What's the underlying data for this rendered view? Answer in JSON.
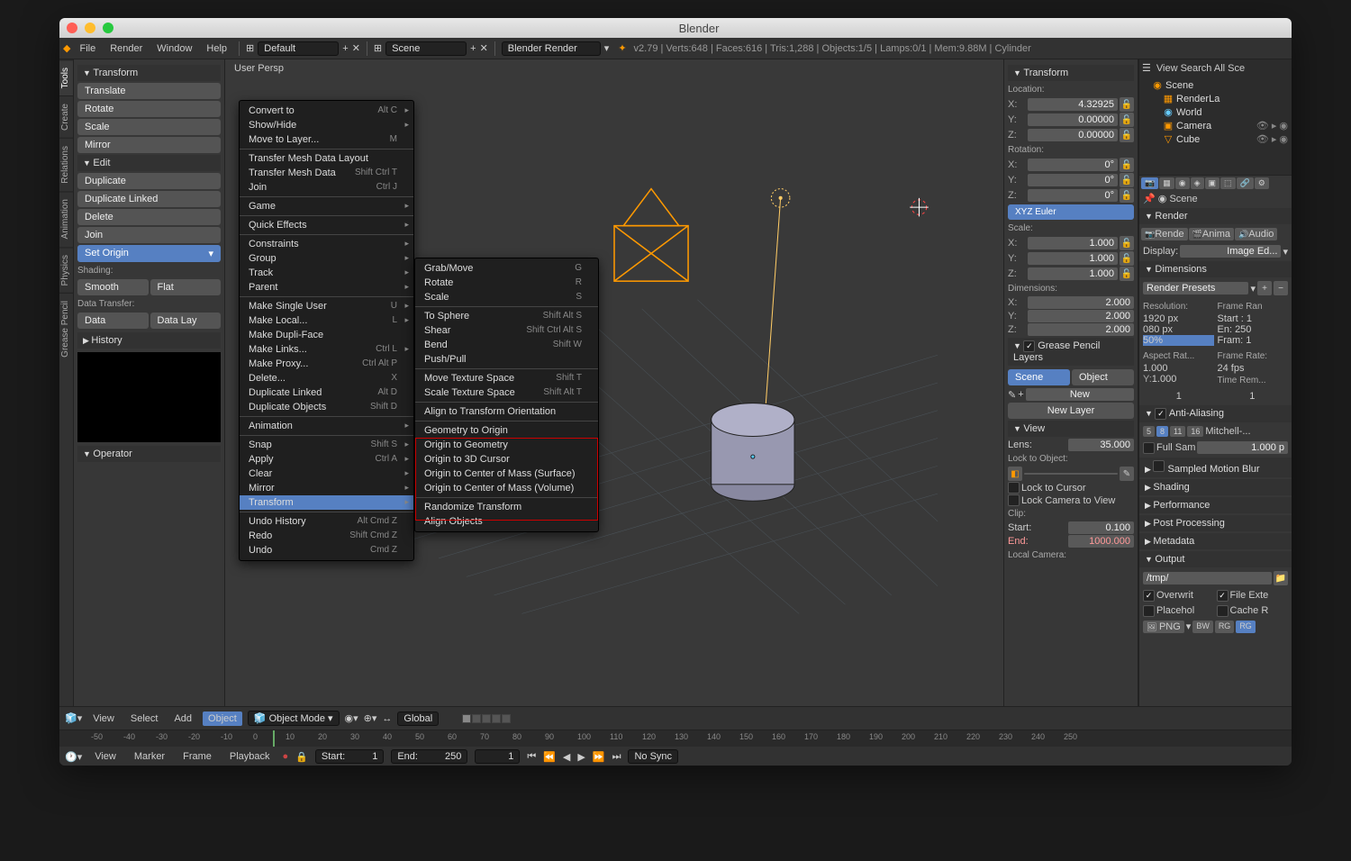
{
  "title": "Blender",
  "menubar": {
    "file": "File",
    "render": "Render",
    "window": "Window",
    "help": "Help",
    "layout": "Default",
    "scene": "Scene",
    "engine": "Blender Render"
  },
  "info": "v2.79 | Verts:648 | Faces:616 | Tris:1,288 | Objects:1/5 | Lamps:0/1 | Mem:9.88M | Cylinder",
  "vtabs": [
    "Tools",
    "Create",
    "Relations",
    "Animation",
    "Physics",
    "Grease Pencil"
  ],
  "toolpanel": {
    "transform": {
      "head": "Transform",
      "translate": "Translate",
      "rotate": "Rotate",
      "scale": "Scale",
      "mirror": "Mirror"
    },
    "edit": {
      "head": "Edit",
      "duplicate": "Duplicate",
      "duplink": "Duplicate Linked",
      "delete": "Delete",
      "join": "Join",
      "setorigin": "Set Origin"
    },
    "shading": {
      "label": "Shading:",
      "smooth": "Smooth",
      "flat": "Flat"
    },
    "datatrans": {
      "label": "Data Transfer:",
      "data": "Data",
      "datalay": "Data Lay"
    },
    "history": "History",
    "operator": "Operator"
  },
  "persp": "User Persp",
  "menu1": [
    {
      "t": "Convert to",
      "s": "Alt C",
      "sub": true
    },
    {
      "t": "Show/Hide",
      "sub": true
    },
    {
      "t": "Move to Layer...",
      "s": "M"
    },
    {
      "sep": true
    },
    {
      "t": "Transfer Mesh Data Layout"
    },
    {
      "t": "Transfer Mesh Data",
      "s": "Shift Ctrl T"
    },
    {
      "t": "Join",
      "s": "Ctrl J"
    },
    {
      "sep": true
    },
    {
      "t": "Game",
      "sub": true
    },
    {
      "sep": true
    },
    {
      "t": "Quick Effects",
      "sub": true
    },
    {
      "sep": true
    },
    {
      "t": "Constraints",
      "sub": true
    },
    {
      "t": "Group",
      "sub": true
    },
    {
      "t": "Track",
      "sub": true
    },
    {
      "t": "Parent",
      "sub": true
    },
    {
      "sep": true
    },
    {
      "t": "Make Single User",
      "s": "U",
      "sub": true
    },
    {
      "t": "Make Local...",
      "s": "L",
      "sub": true
    },
    {
      "t": "Make Dupli-Face"
    },
    {
      "t": "Make Links...",
      "s": "Ctrl L",
      "sub": true
    },
    {
      "t": "Make Proxy...",
      "s": "Ctrl Alt P"
    },
    {
      "t": "Delete...",
      "s": "X"
    },
    {
      "t": "Duplicate Linked",
      "s": "Alt D"
    },
    {
      "t": "Duplicate Objects",
      "s": "Shift D"
    },
    {
      "sep": true
    },
    {
      "t": "Animation",
      "sub": true
    },
    {
      "sep": true
    },
    {
      "t": "Snap",
      "s": "Shift S",
      "sub": true
    },
    {
      "t": "Apply",
      "s": "Ctrl A",
      "sub": true
    },
    {
      "t": "Clear",
      "sub": true
    },
    {
      "t": "Mirror",
      "sub": true
    },
    {
      "t": "Transform",
      "sub": true,
      "hl": true
    },
    {
      "sep": true
    },
    {
      "t": "Undo History",
      "s": "Alt Cmd Z"
    },
    {
      "t": "Redo",
      "s": "Shift Cmd Z"
    },
    {
      "t": "Undo",
      "s": "Cmd Z"
    }
  ],
  "menu2": [
    {
      "t": "Grab/Move",
      "s": "G"
    },
    {
      "t": "Rotate",
      "s": "R"
    },
    {
      "t": "Scale",
      "s": "S"
    },
    {
      "sep": true
    },
    {
      "t": "To Sphere",
      "s": "Shift Alt S"
    },
    {
      "t": "Shear",
      "s": "Shift Ctrl Alt S"
    },
    {
      "t": "Bend",
      "s": "Shift W"
    },
    {
      "t": "Push/Pull"
    },
    {
      "sep": true
    },
    {
      "t": "Move Texture Space",
      "s": "Shift T"
    },
    {
      "t": "Scale Texture Space",
      "s": "Shift Alt T"
    },
    {
      "sep": true
    },
    {
      "t": "Align to Transform Orientation"
    },
    {
      "sep": true
    },
    {
      "t": "Geometry to Origin"
    },
    {
      "t": "Origin to Geometry"
    },
    {
      "t": "Origin to 3D Cursor"
    },
    {
      "t": "Origin to Center of Mass (Surface)"
    },
    {
      "t": "Origin to Center of Mass (Volume)"
    },
    {
      "sep": true
    },
    {
      "t": "Randomize Transform"
    },
    {
      "t": "Align Objects"
    }
  ],
  "npanel": {
    "transform": "Transform",
    "loc": {
      "lbl": "Location:",
      "x": "4.32925",
      "y": "0.00000",
      "z": "0.00000"
    },
    "rot": {
      "lbl": "Rotation:",
      "x": "0°",
      "y": "0°",
      "z": "0°",
      "order": "XYZ Euler"
    },
    "scale": {
      "lbl": "Scale:",
      "x": "1.000",
      "y": "1.000",
      "z": "1.000"
    },
    "dim": {
      "lbl": "Dimensions:",
      "x": "2.000",
      "y": "2.000",
      "z": "2.000"
    },
    "gp": {
      "head": "Grease Pencil Layers",
      "scene": "Scene",
      "object": "Object",
      "new": "New",
      "newlayer": "New Layer"
    },
    "view": {
      "head": "View",
      "lens": "Lens:",
      "lensv": "35.000",
      "lockobj": "Lock to Object:",
      "lockcur": "Lock to Cursor",
      "lockcam": "Lock Camera to View",
      "clip": "Clip:",
      "start": "Start:",
      "startv": "0.100",
      "end": "End:",
      "endv": "1000.000",
      "localcam": "Local Camera:"
    }
  },
  "outliner": {
    "top": "View   Search   All Sce",
    "scene": "Scene",
    "renderla": "RenderLa",
    "world": "World",
    "camera": "Camera",
    "cube": "Cube"
  },
  "props": {
    "pin": "Scene",
    "render": "Render",
    "rendertabs": [
      "Rende",
      "Anima",
      "Audio"
    ],
    "display": "Display:",
    "displayv": "Image Ed...",
    "dimensions": "Dimensions",
    "presets": "Render Presets",
    "res": "Resolution:",
    "resx": "1920 px",
    "resy": "080 px",
    "pct": "50%",
    "frame": "Frame Ran",
    "fstart": "Start : 1",
    "fend": "En: 250",
    "fstep": "Fram: 1",
    "aspect": "Aspect Rat...",
    "ax": "1.000",
    "ay": "1.000",
    "framerate": "Frame Rate:",
    "fps": "24 fps",
    "timerem": "Time Rem...",
    "one1": "1",
    "one2": "1",
    "aa": "Anti-Aliasing",
    "samples": [
      "5",
      "8",
      "11",
      "16"
    ],
    "mitchell": "Mitchell-...",
    "fullsam": "Full Sam",
    "fullsamv": "1.000 p",
    "smb": "Sampled Motion Blur",
    "shading": "Shading",
    "perf": "Performance",
    "post": "Post Processing",
    "meta": "Metadata",
    "output": "Output",
    "path": "/tmp/",
    "overwrite": "Overwrit",
    "fileext": "File Exte",
    "placehold": "Placehol",
    "cache": "Cache R",
    "format": "PNG",
    "bw": "BW",
    "rg1": "RG",
    "rg2": "RG"
  },
  "header3d": {
    "view": "View",
    "select": "Select",
    "add": "Add",
    "object": "Object",
    "mode": "Object Mode",
    "global": "Global"
  },
  "timeline": {
    "view": "View",
    "marker": "Marker",
    "frame": "Frame",
    "playback": "Playback",
    "start": "Start:",
    "startv": "1",
    "end": "End:",
    "endv": "250",
    "cur": "1",
    "sync": "No Sync",
    "ticks": [
      "-50",
      "-40",
      "-30",
      "-20",
      "-10",
      "0",
      "10",
      "20",
      "30",
      "40",
      "50",
      "60",
      "70",
      "80",
      "90",
      "100",
      "110",
      "120",
      "130",
      "140",
      "150",
      "160",
      "170",
      "180",
      "190",
      "200",
      "210",
      "220",
      "230",
      "240",
      "250"
    ]
  }
}
